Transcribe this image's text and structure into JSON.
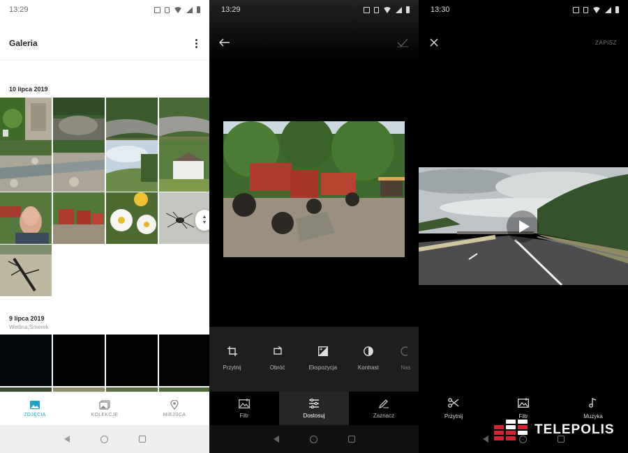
{
  "gallery": {
    "status_time": "13:29",
    "title": "Galeria",
    "section1_date": "10 lipca 2019",
    "section2_date": "9 lipca 2019",
    "section2_location": "Wetlina,Smerek",
    "nav": [
      {
        "label": "ZDJĘCIA",
        "icon": "photos-icon",
        "active": true
      },
      {
        "label": "KOLEKCJE",
        "icon": "collections-icon",
        "active": false
      },
      {
        "label": "MIEJSCA",
        "icon": "places-icon",
        "active": false
      }
    ]
  },
  "editor": {
    "status_time": "13:29",
    "tools": [
      {
        "label": "Przytnij",
        "icon": "crop-icon"
      },
      {
        "label": "Obróć",
        "icon": "rotate-icon"
      },
      {
        "label": "Ekspozycja",
        "icon": "exposure-icon"
      },
      {
        "label": "Kontrast",
        "icon": "contrast-icon"
      },
      {
        "label": "Nas",
        "icon": "saturation-icon"
      }
    ],
    "tabs": [
      {
        "label": "Filtr",
        "icon": "filter-icon",
        "active": false
      },
      {
        "label": "Dostosuj",
        "icon": "adjust-icon",
        "active": true
      },
      {
        "label": "Zaznacz",
        "icon": "markup-icon",
        "active": false
      }
    ]
  },
  "video_editor": {
    "status_time": "13:30",
    "save_label": "ZAPISZ",
    "tools": [
      {
        "label": "Przytnij",
        "icon": "scissors-icon"
      },
      {
        "label": "Filtr",
        "icon": "filter-icon"
      },
      {
        "label": "Muzyka",
        "icon": "music-icon"
      }
    ]
  },
  "watermark": {
    "text": "TELEPOLIS"
  },
  "colors": {
    "accent": "#1aa5c7",
    "logo_red": "#d6232f"
  }
}
